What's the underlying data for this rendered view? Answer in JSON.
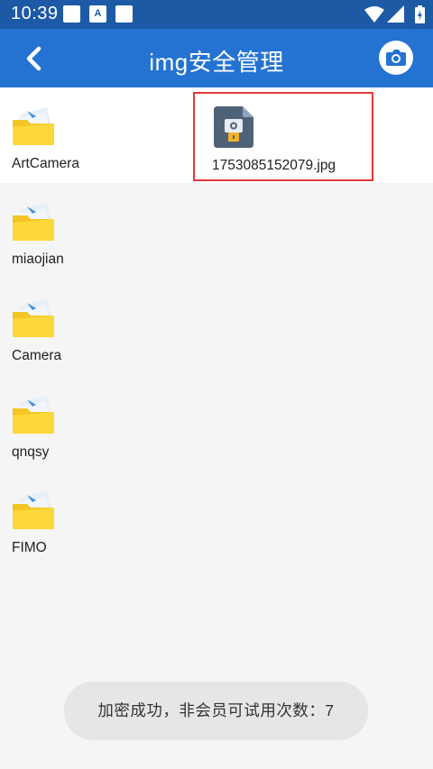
{
  "status_bar": {
    "time": "10:39",
    "notification_icons": [
      "square-notification-icon",
      "a-notification-icon",
      "square-notification-icon"
    ],
    "system_icons": [
      "wifi-icon",
      "signal-icon",
      "battery-charging-icon"
    ],
    "color": "#1d5aa6"
  },
  "app_bar": {
    "title": "img安全管理",
    "back_icon": "chevron-left-icon",
    "action_icon": "camera-icon",
    "color": "#2473d2"
  },
  "items": [
    {
      "type": "folder",
      "label": "ArtCamera",
      "icon": "folder-icon"
    },
    {
      "type": "file",
      "label": "1753085152079.jpg",
      "icon": "encrypted-image-file-icon",
      "selected": true
    },
    {
      "type": "folder",
      "label": "miaojian",
      "icon": "folder-icon"
    },
    {
      "type": "folder",
      "label": "Camera",
      "icon": "folder-icon"
    },
    {
      "type": "folder",
      "label": "qnqsy",
      "icon": "folder-icon"
    },
    {
      "type": "folder",
      "label": "FIMO",
      "icon": "folder-icon"
    }
  ],
  "toast": {
    "message": "加密成功，非会员可试用次数：7"
  }
}
